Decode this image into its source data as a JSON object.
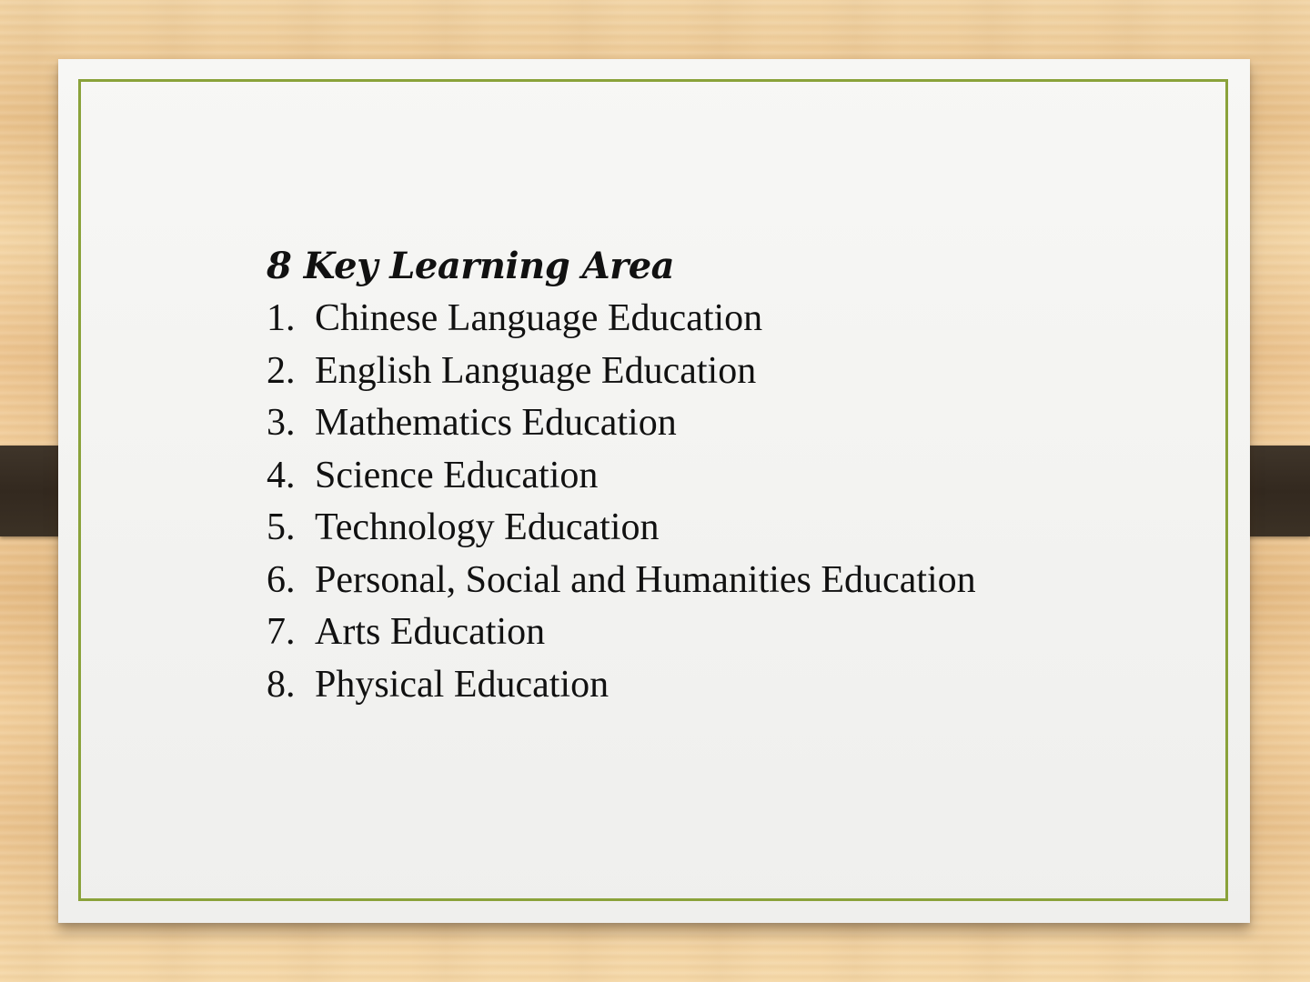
{
  "slide": {
    "heading": "8 Key Learning Area",
    "items": [
      {
        "number": "1.",
        "label": "Chinese Language Education"
      },
      {
        "number": "2.",
        "label": "English Language Education"
      },
      {
        "number": "3.",
        "label": "Mathematics Education"
      },
      {
        "number": "4.",
        "label": "Science Education"
      },
      {
        "number": "5.",
        "label": "Technology Education"
      },
      {
        "number": "6.",
        "label": "Personal, Social and Humanities Education"
      },
      {
        "number": "7.",
        "label": "Arts Education"
      },
      {
        "number": "8.",
        "label": "Physical Education"
      }
    ]
  },
  "colors": {
    "frame_border": "#8aa23a",
    "card_background": "#f4f4f2",
    "strap": "#3a3026",
    "text": "#111111"
  }
}
